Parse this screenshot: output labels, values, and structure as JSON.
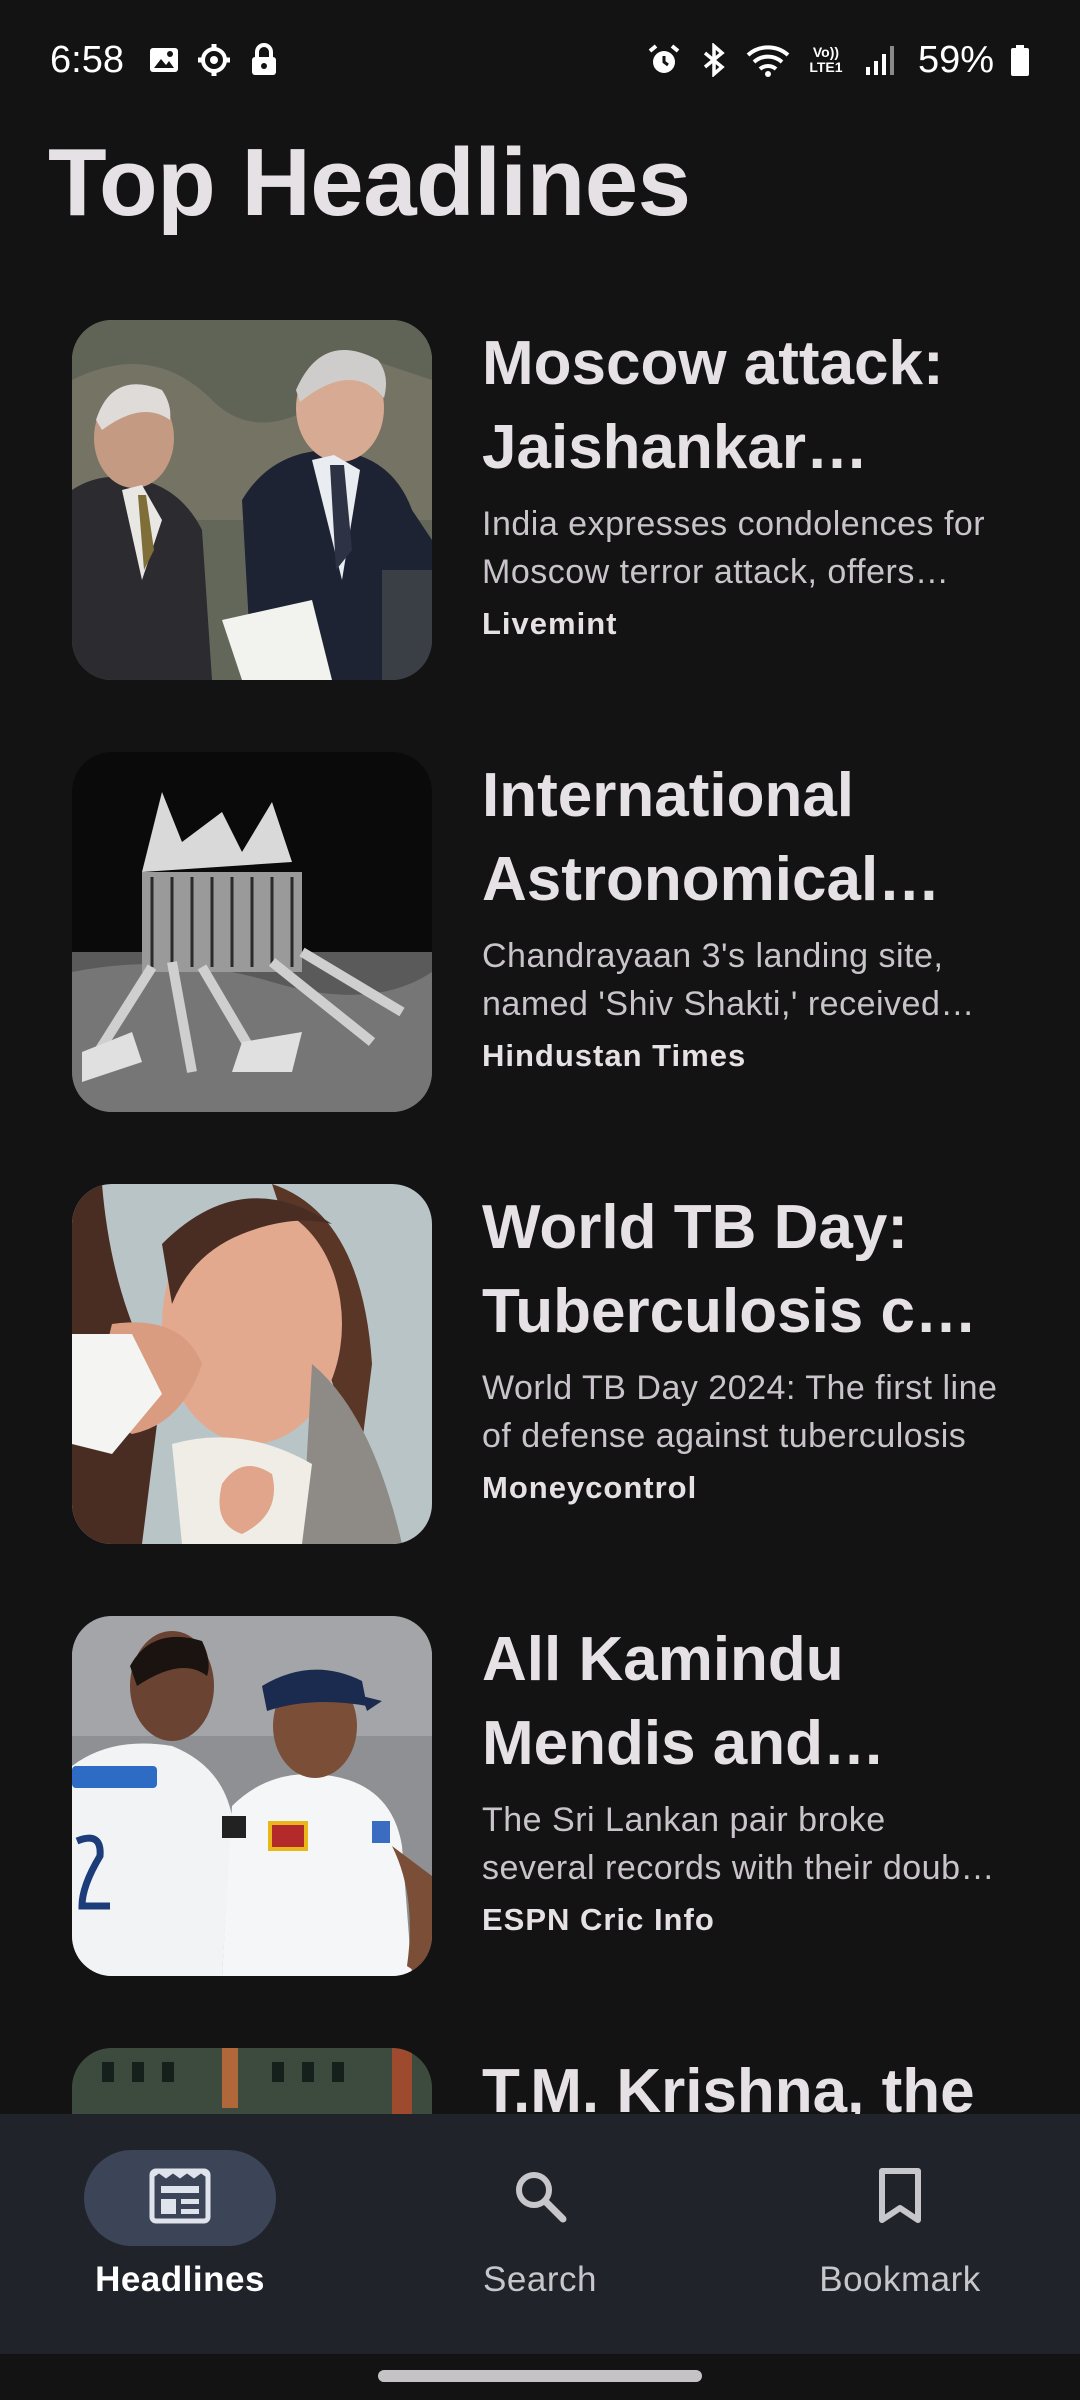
{
  "status_bar": {
    "time": "6:58",
    "battery": "59%",
    "left_icons": [
      "image-icon",
      "settings-gear-icon",
      "lock-icon"
    ],
    "right_icons": [
      "alarm-icon",
      "bluetooth-icon",
      "wifi-icon",
      "volte-icon",
      "signal-icon",
      "battery-icon"
    ],
    "volte_text": "Vo)) LTE1"
  },
  "page": {
    "title": "Top Headlines"
  },
  "articles": [
    {
      "title": "Moscow attack: Jaishankar dialled Russia's Lavrov",
      "description": "India expresses condolences for Moscow terror attack, offers support",
      "source": "Livemint"
    },
    {
      "title": "International Astronomical Union approves name",
      "description": "Chandrayaan 3's landing site, named 'Shiv Shakti,' received approval",
      "source": "Hindustan Times"
    },
    {
      "title": "World TB Day: Tuberculosis can be prevented",
      "description": "World TB Day 2024: The first line of defense against tuberculosis",
      "source": "Moneycontrol"
    },
    {
      "title": "All Kamindu Mendis and Dhananjaya de Silva",
      "description": "The Sri Lankan pair broke several records with their double centuries",
      "source": "ESPN Cric Info"
    },
    {
      "title": "T.M. Krishna, the",
      "description": "",
      "source": ""
    }
  ],
  "bottom_nav": {
    "items": [
      {
        "label": "Headlines",
        "icon": "newspaper-icon",
        "active": true
      },
      {
        "label": "Search",
        "icon": "search-icon",
        "active": false
      },
      {
        "label": "Bookmark",
        "icon": "bookmark-icon",
        "active": false
      }
    ]
  },
  "colors": {
    "background": "#141314",
    "nav_background": "#202329",
    "active_indicator": "#3c4557",
    "text_primary": "#e6e1e5",
    "text_secondary": "#c9c4ca"
  }
}
